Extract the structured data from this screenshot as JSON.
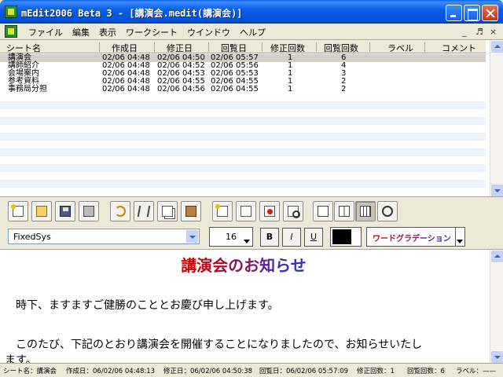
{
  "window": {
    "title": "mEdit2006  Beta 3 - [講演会.medit(講演会)]"
  },
  "menu": {
    "items": [
      "ファイル",
      "編集",
      "表示",
      "ワークシート",
      "ウインドウ",
      "ヘルプ"
    ],
    "mdi_controls": [
      "_",
      "♬",
      "×"
    ]
  },
  "sheet_list": {
    "columns": [
      "シート名",
      "作成日",
      "修正日",
      "回覧日",
      "修正回数",
      "回覧回数",
      "ラベル",
      "コメント"
    ],
    "rows": [
      [
        "講演会",
        "02/06 04:48",
        "02/06 04:50",
        "02/06 05:57",
        "1",
        "6",
        "",
        ""
      ],
      [
        "講師紹介",
        "02/06 04:48",
        "02/06 04:52",
        "02/06 05:56",
        "1",
        "4",
        "",
        ""
      ],
      [
        "会場案内",
        "02/06 04:48",
        "02/06 04:53",
        "02/06 05:53",
        "1",
        "3",
        "",
        ""
      ],
      [
        "参考資料",
        "02/06 04:48",
        "02/06 04:55",
        "02/06 04:55",
        "1",
        "2",
        "",
        ""
      ],
      [
        "事務局分担",
        "02/06 04:48",
        "02/06 04:56",
        "02/06 04:55",
        "1",
        "2",
        "",
        ""
      ]
    ]
  },
  "toolbar": {
    "buttons": [
      "new-sheet",
      "open",
      "save",
      "print",
      "undo",
      "cut",
      "copy",
      "paste",
      "new-page",
      "duplicate",
      "delete",
      "preview",
      "view-single",
      "view-double",
      "view-triple",
      "zoom"
    ]
  },
  "format": {
    "font": "FixedSys",
    "size": "16",
    "bold": "B",
    "italic": "I",
    "underline": "U",
    "color": "#000000",
    "gradation_label": "ワードグラデーション"
  },
  "editor": {
    "heading": "講演会のお知らせ",
    "line1": "時下、ますますご健勝のこととお慶び申し上げます。",
    "line2": "このたび、下記のとおり講演会を開催することになりましたので、お知らせいたし",
    "line3": "ます。"
  },
  "status": {
    "sheet": "シート名：講演会",
    "created": "作成日：06/02/06 04:48:13",
    "modified": "修正日：06/02/06 04:50:38",
    "viewed": "回覧日：06/02/06 05:57:09",
    "mod_count": "修正回数：1",
    "view_count": "回覧回数：6",
    "label": "ラベル：——"
  }
}
